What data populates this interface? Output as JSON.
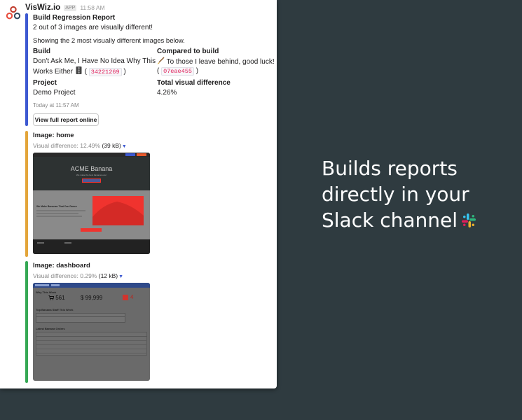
{
  "message": {
    "sender": "VisWiz.io",
    "app_tag": "APP",
    "time": "11:58 AM"
  },
  "report": {
    "title": "Build Regression Report",
    "summary": "2 out of 3 images are visually different!",
    "showing": "Showing the 2 most visually different images below.",
    "build_label": "Build",
    "build_line1": "Don't Ask Me, I Have No Idea Why This",
    "build_line2": "Works Either",
    "build_hash": "34221269",
    "compared_label": "Compared to build",
    "compared_line1": "To those I leave behind, good luck!",
    "compared_hash": "07eae455",
    "project_label": "Project",
    "project_value": "Demo Project",
    "diff_label": "Total visual difference",
    "diff_value": "4.26%",
    "footer_time": "Today at 11:57 AM",
    "button_label": "View full report online"
  },
  "images": [
    {
      "title": "Image: home",
      "diff_text": "Visual difference: 12.49%",
      "size": "(39 kB)",
      "preview": {
        "hero_title": "ACME Banana",
        "hero_sub": "We make the best bananas ever",
        "section_title": "We Make Bananas That Can Dance"
      }
    },
    {
      "title": "Image: dashboard",
      "diff_text": "Visual difference: 0.29%",
      "size": "(12 kB)",
      "preview": {
        "section1": "Why This Week",
        "stat1": "561",
        "stat2": "$ 99,999",
        "stat3": "4",
        "section2": "Top Banana Staff This Week",
        "section3": "Latest Banana Orders"
      }
    }
  ],
  "promo": {
    "line1": "Builds reports",
    "line2": "directly in your",
    "line3": "Slack channel"
  },
  "colors": {
    "bar_report": "#3d59d1",
    "bar_home": "#e3a53a",
    "bar_dashboard": "#35a854",
    "diff_highlight": "#f0332e",
    "background": "#2f3b40"
  }
}
